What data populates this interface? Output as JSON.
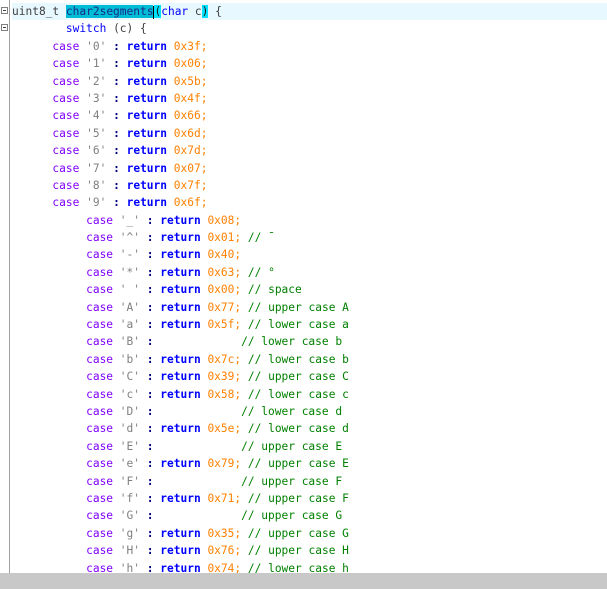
{
  "editor": {
    "header": {
      "type": "uint8_t",
      "function": "char2segments",
      "open_paren": "(",
      "param_type": "char",
      "param": "c",
      "close_paren": ")",
      "brace": "{"
    },
    "switch_line": {
      "keyword": "switch",
      "expr": "(c)",
      "brace": "{"
    },
    "digit_cases": [
      {
        "kw": "case",
        "ch": "'0'",
        "sep": ":",
        "ret": "return",
        "val": "0x3f;"
      },
      {
        "kw": "case",
        "ch": "'1'",
        "sep": ":",
        "ret": "return",
        "val": "0x06;"
      },
      {
        "kw": "case",
        "ch": "'2'",
        "sep": ":",
        "ret": "return",
        "val": "0x5b;"
      },
      {
        "kw": "case",
        "ch": "'3'",
        "sep": ":",
        "ret": "return",
        "val": "0x4f;"
      },
      {
        "kw": "case",
        "ch": "'4'",
        "sep": ":",
        "ret": "return",
        "val": "0x66;"
      },
      {
        "kw": "case",
        "ch": "'5'",
        "sep": ":",
        "ret": "return",
        "val": "0x6d;"
      },
      {
        "kw": "case",
        "ch": "'6'",
        "sep": ":",
        "ret": "return",
        "val": "0x7d;"
      },
      {
        "kw": "case",
        "ch": "'7'",
        "sep": ":",
        "ret": "return",
        "val": "0x07;"
      },
      {
        "kw": "case",
        "ch": "'8'",
        "sep": ":",
        "ret": "return",
        "val": "0x7f;"
      },
      {
        "kw": "case",
        "ch": "'9'",
        "sep": ":",
        "ret": "return",
        "val": "0x6f;"
      }
    ],
    "symbol_cases": [
      {
        "kw": "case",
        "ch": "'_'",
        "sep": ":",
        "ret": "return",
        "val": "0x08;",
        "comment": ""
      },
      {
        "kw": "case",
        "ch": "'^'",
        "sep": ":",
        "ret": "return",
        "val": "0x01;",
        "comment": "// ¯"
      },
      {
        "kw": "case",
        "ch": "'-'",
        "sep": ":",
        "ret": "return",
        "val": "0x40;",
        "comment": ""
      },
      {
        "kw": "case",
        "ch": "'*'",
        "sep": ":",
        "ret": "return",
        "val": "0x63;",
        "comment": "// °"
      },
      {
        "kw": "case",
        "ch": "' '",
        "sep": ":",
        "ret": "return",
        "val": "0x00;",
        "comment": "// space"
      },
      {
        "kw": "case",
        "ch": "'A'",
        "sep": ":",
        "ret": "return",
        "val": "0x77;",
        "comment": "// upper case A"
      },
      {
        "kw": "case",
        "ch": "'a'",
        "sep": ":",
        "ret": "return",
        "val": "0x5f;",
        "comment": "// lower case a"
      },
      {
        "kw": "case",
        "ch": "'B'",
        "sep": ":",
        "ret": "",
        "val": "",
        "comment": "// lower case b"
      },
      {
        "kw": "case",
        "ch": "'b'",
        "sep": ":",
        "ret": "return",
        "val": "0x7c;",
        "comment": "// lower case b"
      },
      {
        "kw": "case",
        "ch": "'C'",
        "sep": ":",
        "ret": "return",
        "val": "0x39;",
        "comment": "// upper case C"
      },
      {
        "kw": "case",
        "ch": "'c'",
        "sep": ":",
        "ret": "return",
        "val": "0x58;",
        "comment": "// lower case c"
      },
      {
        "kw": "case",
        "ch": "'D'",
        "sep": ":",
        "ret": "",
        "val": "",
        "comment": "// lower case d"
      },
      {
        "kw": "case",
        "ch": "'d'",
        "sep": ":",
        "ret": "return",
        "val": "0x5e;",
        "comment": "// lower case d"
      },
      {
        "kw": "case",
        "ch": "'E'",
        "sep": ":",
        "ret": "",
        "val": "",
        "comment": "// upper case E"
      },
      {
        "kw": "case",
        "ch": "'e'",
        "sep": ":",
        "ret": "return",
        "val": "0x79;",
        "comment": "// upper case E"
      },
      {
        "kw": "case",
        "ch": "'F'",
        "sep": ":",
        "ret": "",
        "val": "",
        "comment": "// upper case F"
      },
      {
        "kw": "case",
        "ch": "'f'",
        "sep": ":",
        "ret": "return",
        "val": "0x71;",
        "comment": "// upper case F"
      },
      {
        "kw": "case",
        "ch": "'G'",
        "sep": ":",
        "ret": "",
        "val": "",
        "comment": "// upper case G"
      },
      {
        "kw": "case",
        "ch": "'g'",
        "sep": ":",
        "ret": "return",
        "val": "0x35;",
        "comment": "// upper case G"
      },
      {
        "kw": "case",
        "ch": "'H'",
        "sep": ":",
        "ret": "return",
        "val": "0x76;",
        "comment": "// upper case H"
      },
      {
        "kw": "case",
        "ch": "'h'",
        "sep": ":",
        "ret": "return",
        "val": "0x74;",
        "comment": "// lower case h"
      }
    ],
    "colors": {
      "background": "#ffffff",
      "current_line": "#e8f8ff",
      "selection": "#00bcd4",
      "brace_match": "#00e0ff",
      "keyword": "#0000ff",
      "case_keyword": "#8000ff",
      "string": "#808080",
      "number": "#ff8000",
      "comment": "#008000",
      "scrollbar": "#c8c8c8"
    }
  }
}
